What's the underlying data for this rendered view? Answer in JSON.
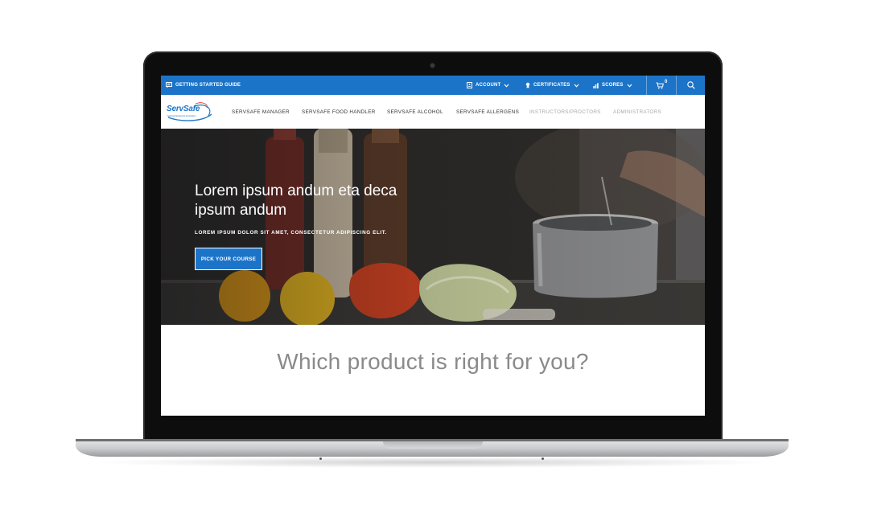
{
  "topbar": {
    "guide_label": "GETTING STARTED GUIDE",
    "account_label": "ACCOUNT",
    "certificates_label": "CERTIFICATES",
    "scores_label": "SCORES",
    "cart_count": "0",
    "background": "#1c74c8"
  },
  "logo": {
    "text": "ServSafe",
    "tagline": "National Restaurant Association"
  },
  "nav": {
    "items": [
      {
        "label": "SERVSAFE MANAGER"
      },
      {
        "label": "SERVSAFE FOOD HANDLER"
      },
      {
        "label": "SERVSAFE ALCOHOL"
      },
      {
        "label": "SERVSAFE ALLERGENS"
      },
      {
        "label": "INSTRUCTORS/PROCTORS"
      },
      {
        "label": "ADMINISTRATORS"
      }
    ]
  },
  "hero": {
    "title": "Lorem ipsum andum eta deca ipsum andum",
    "subtitle": "LOREM IPSUM DOLOR SIT AMET, CONSECTETUR ADIPISCING ELIT.",
    "button_label": "PICK YOUR COURSE"
  },
  "section": {
    "question": "Which product is right for you?"
  },
  "icons": {
    "guide": "chat-icon",
    "account": "account-icon",
    "certificates": "certificate-icon",
    "scores": "bar-chart-icon",
    "cart": "cart-icon",
    "search": "search-icon"
  }
}
